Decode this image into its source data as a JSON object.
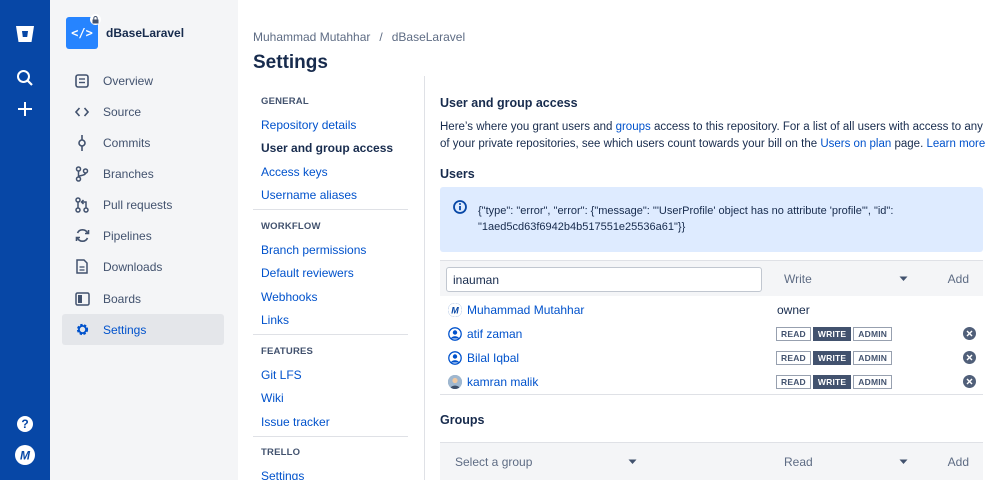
{
  "project": {
    "name": "dBaseLaravel",
    "avatar_glyph": "</>"
  },
  "sidebar": {
    "items": [
      {
        "label": "Overview"
      },
      {
        "label": "Source"
      },
      {
        "label": "Commits"
      },
      {
        "label": "Branches"
      },
      {
        "label": "Pull requests"
      },
      {
        "label": "Pipelines"
      },
      {
        "label": "Downloads"
      },
      {
        "label": "Boards"
      },
      {
        "label": "Settings"
      }
    ]
  },
  "breadcrumb": {
    "owner": "Muhammad Mutahhar",
    "separator": "/",
    "repo": "dBaseLaravel"
  },
  "page": {
    "title": "Settings"
  },
  "settings_nav": {
    "general": {
      "title": "GENERAL",
      "links": [
        "Repository details",
        "User and group access",
        "Access keys",
        "Username aliases"
      ]
    },
    "workflow": {
      "title": "WORKFLOW",
      "links": [
        "Branch permissions",
        "Default reviewers",
        "Webhooks",
        "Links"
      ]
    },
    "features": {
      "title": "FEATURES",
      "links": [
        "Git LFS",
        "Wiki",
        "Issue tracker"
      ]
    },
    "trello": {
      "title": "TRELLO",
      "links": [
        "Settings"
      ]
    }
  },
  "content": {
    "title": "User and group access",
    "desc": {
      "p1": "Here’s where you grant users and ",
      "link_groups": "groups",
      "p2": " access to this repository. For a list of all users with access to any of your private repositories, see which users count towards your bill on the ",
      "link_users_on_plan": "Users on plan",
      "p3": " page. ",
      "link_learn_more": "Learn more"
    },
    "users_title": "Users",
    "error": "{\"type\": \"error\", \"error\": {\"message\": \"'UserProfile' object has no attribute 'profile'\", \"id\": \"1aed5cd63f6942b4b517551e25536a61\"}}",
    "add_user": {
      "value": "inauman",
      "permission": "Write",
      "add_label": "Add"
    },
    "users": [
      {
        "name": "Muhammad Mutahhar",
        "role": "owner"
      },
      {
        "name": "atif zaman"
      },
      {
        "name": "Bilal Iqbal"
      },
      {
        "name": "kamran malik"
      }
    ],
    "permission_badges": [
      "READ",
      "WRITE",
      "ADMIN"
    ],
    "groups_title": "Groups",
    "add_group": {
      "placeholder": "Select a group",
      "permission": "Read",
      "add_label": "Add"
    }
  },
  "colors": {
    "global_nav": "#0747a6",
    "link": "#0052cc",
    "alert_bg": "#deebff",
    "text": "#172b4d"
  }
}
